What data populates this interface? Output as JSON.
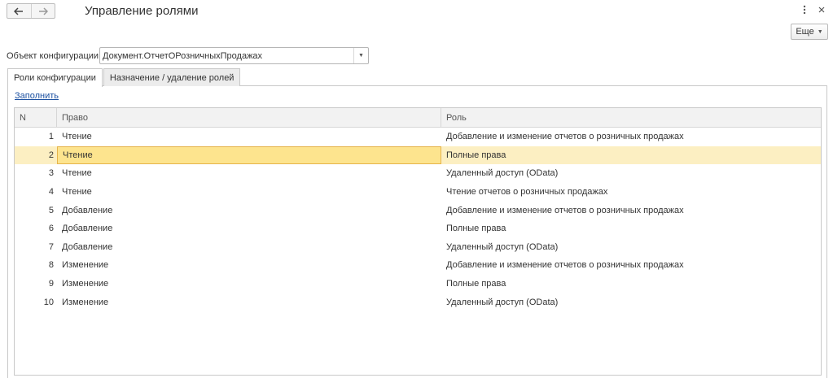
{
  "window": {
    "title": "Управление ролями",
    "more_label": "Еще"
  },
  "object": {
    "label": "Объект конфигурации:",
    "value": "Документ.ОтчетОРозничныхПродажах"
  },
  "tabs": [
    {
      "label": "Роли конфигурации",
      "active": true
    },
    {
      "label": "Назначение / удаление ролей",
      "active": false
    }
  ],
  "fill_link": "Заполнить",
  "table": {
    "columns": {
      "n": "N",
      "right": "Право",
      "role": "Роль"
    },
    "selected_index": 1,
    "rows": [
      {
        "n": "1",
        "right": "Чтение",
        "role": "Добавление и изменение отчетов о розничных продажах"
      },
      {
        "n": "2",
        "right": "Чтение",
        "role": "Полные права"
      },
      {
        "n": "3",
        "right": "Чтение",
        "role": "Удаленный доступ (OData)"
      },
      {
        "n": "4",
        "right": "Чтение",
        "role": "Чтение отчетов о розничных продажах"
      },
      {
        "n": "5",
        "right": "Добавление",
        "role": "Добавление и изменение отчетов о розничных продажах"
      },
      {
        "n": "6",
        "right": "Добавление",
        "role": "Полные права"
      },
      {
        "n": "7",
        "right": "Добавление",
        "role": "Удаленный доступ (OData)"
      },
      {
        "n": "8",
        "right": "Изменение",
        "role": "Добавление и изменение отчетов о розничных продажах"
      },
      {
        "n": "9",
        "right": "Изменение",
        "role": "Полные права"
      },
      {
        "n": "10",
        "right": "Изменение",
        "role": "Удаленный доступ (OData)"
      }
    ]
  }
}
